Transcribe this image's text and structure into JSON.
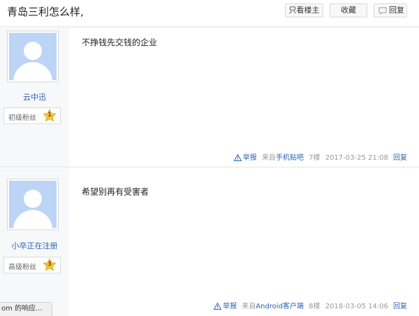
{
  "header": {
    "title": "青岛三利怎么样,",
    "only_author_label": "只看楼主",
    "favorite_label": "收藏",
    "reply_label": "回复"
  },
  "posts": [
    {
      "username": "云中迅",
      "fan_level_label": "初级粉丝",
      "fan_level": "1",
      "content": "不挣钱先交钱的企业",
      "report_label": "举报",
      "client_prefix": "来自",
      "client": "手机贴吧",
      "floor": "7楼",
      "time": "2017-03-25 21:08",
      "reply_label": "回复"
    },
    {
      "username": "小卒正在注册",
      "fan_level_label": "高级粉丝",
      "fan_level": "3",
      "content": "希望别再有受害者",
      "report_label": "举报",
      "client_prefix": "来自",
      "client": "Android客户端",
      "floor": "8楼",
      "time": "2018-03-05 14:06",
      "reply_label": "回复"
    }
  ],
  "status_bar": {
    "text": "om 的响应..."
  },
  "colors": {
    "link_blue": "#2d64b3",
    "avatar_bg": "#bcd4f6",
    "star_gold": "#f5c542"
  }
}
